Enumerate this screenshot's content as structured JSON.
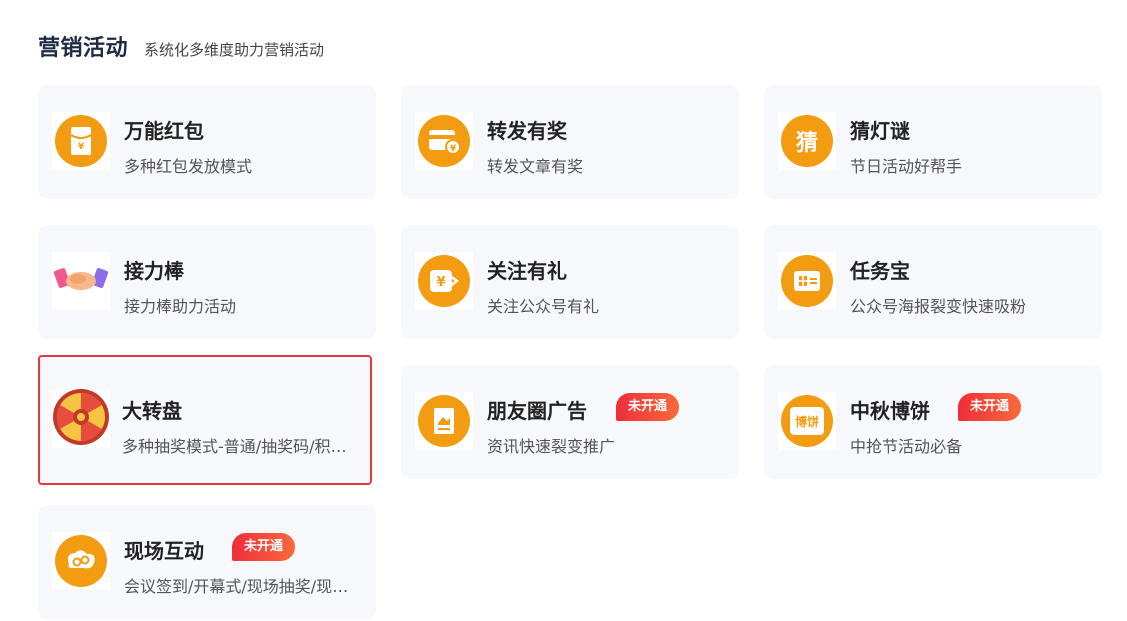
{
  "header": {
    "title": "营销活动",
    "subtitle": "系统化多维度助力营销活动"
  },
  "cards": [
    {
      "name": "万能红包",
      "desc": "多种红包发放模式",
      "icon": "red-envelope-icon",
      "badge": ""
    },
    {
      "name": "转发有奖",
      "desc": "转发文章有奖",
      "icon": "forward-reward-icon",
      "badge": ""
    },
    {
      "name": "猜灯谜",
      "desc": "节日活动好帮手",
      "icon": "lantern-riddle-icon",
      "badge": "",
      "glyph": "猜"
    },
    {
      "name": "接力棒",
      "desc": "接力棒助力活动",
      "icon": "handshake-icon",
      "badge": ""
    },
    {
      "name": "关注有礼",
      "desc": "关注公众号有礼",
      "icon": "follow-gift-icon",
      "badge": ""
    },
    {
      "name": "任务宝",
      "desc": "公众号海报裂变快速吸粉",
      "icon": "task-treasure-icon",
      "badge": ""
    },
    {
      "name": "大转盘",
      "desc": "多种抽奖模式-普通/抽奖码/积分抽奖",
      "icon": "lucky-wheel-icon",
      "badge": "",
      "selected": true
    },
    {
      "name": "朋友圈广告",
      "desc": "资讯快速裂变推广",
      "icon": "moments-ad-icon",
      "badge": "未开通"
    },
    {
      "name": "中秋博饼",
      "desc": "中抢节活动必备",
      "icon": "mooncake-icon",
      "badge": "未开通",
      "glyph": "博饼"
    },
    {
      "name": "现场互动",
      "desc": "会议签到/开幕式/现场抽奖/现场互动",
      "icon": "live-interaction-icon",
      "badge": "未开通"
    }
  ],
  "colors": {
    "accent": "#f39c12",
    "badge": "#ee2d3a",
    "selected_border": "#e0393e",
    "card_bg": "#f7f8fc"
  }
}
